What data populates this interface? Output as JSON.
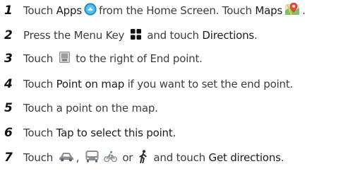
{
  "steps": [
    {
      "number": "1",
      "parts": [
        {
          "t": "Touch "
        },
        {
          "t": "Apps",
          "hl": true
        },
        {
          "icon": "apps-icon"
        },
        {
          "t": "from the Home Screen. Touch "
        },
        {
          "t": "Maps",
          "hl": true
        },
        {
          "icon": "maps-icon"
        },
        {
          "t": "."
        }
      ]
    },
    {
      "number": "2",
      "parts": [
        {
          "t": "Press the Menu Key "
        },
        {
          "icon": "menu-key-icon"
        },
        {
          "t": " and touch "
        },
        {
          "t": "Directions",
          "hl": true
        },
        {
          "t": "."
        }
      ]
    },
    {
      "number": "3",
      "parts": [
        {
          "t": "Touch "
        },
        {
          "icon": "bookmark-icon"
        },
        {
          "t": " to the right of End point."
        }
      ]
    },
    {
      "number": "4",
      "parts": [
        {
          "t": "Touch "
        },
        {
          "t": "Point on map",
          "hl": true
        },
        {
          "t": " if you want to set the end point."
        }
      ]
    },
    {
      "number": "5",
      "parts": [
        {
          "t": "Touch a point on the map."
        }
      ]
    },
    {
      "number": "6",
      "parts": [
        {
          "t": "Touch "
        },
        {
          "t": "Tap to select this point",
          "hl": true
        },
        {
          "t": "."
        }
      ]
    },
    {
      "number": "7",
      "parts": [
        {
          "t": "Touch "
        },
        {
          "icon": "car-icon"
        },
        {
          "t": ", "
        },
        {
          "icon": "bus-icon"
        },
        {
          "icon": "bicycle-icon"
        },
        {
          "t": " or "
        },
        {
          "icon": "walking-icon"
        },
        {
          "t": " and touch "
        },
        {
          "t": "Get directions",
          "hl": true
        },
        {
          "t": "."
        }
      ]
    }
  ],
  "colors": {
    "step_number": "#111111",
    "body_text": "#3d3d3d",
    "highlight_text": "#1c1c1c",
    "apps_icon": "#2a9fd8",
    "transport_icons": "#8a8f96"
  }
}
